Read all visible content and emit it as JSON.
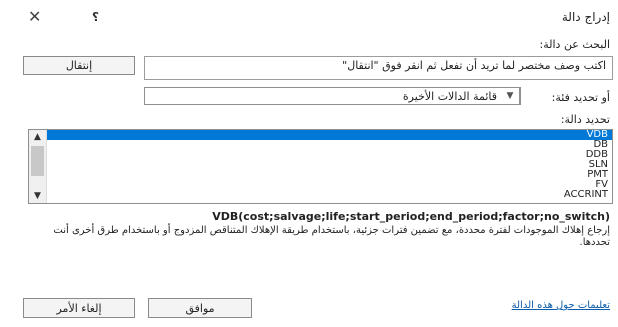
{
  "window": {
    "title": "إدراج دالة"
  },
  "search": {
    "label": "البحث عن دالة:",
    "value": "اكتب وصف مختصر لما تريد أن تفعل ثم انقر فوق \"انتقال\"",
    "go_label": "إنتقال"
  },
  "category": {
    "label": "أو تحديد فئة:",
    "selected": "قائمة الدالات الأخيرة"
  },
  "functions": {
    "label": "تحديد دالة:",
    "items": [
      "VDB",
      "DB",
      "DDB",
      "SLN",
      "PMT",
      "FV",
      "ACCRINT"
    ],
    "selected": "VDB"
  },
  "details": {
    "signature": "VDB(cost;salvage;life;start_period;end_period;factor;no_switch)",
    "description": "إرجاع إهلاك الموجودات لفترة محددة، مع تضمين فترات جزئية، باستخدام طريقة الإهلاك المتناقص المزدوج أو باستخدام طرق أخرى أنت تحددها."
  },
  "footer": {
    "help_link": "تعليمات حول هذه الدالة",
    "ok_label": "موافق",
    "cancel_label": "إلغاء الأمر"
  },
  "icons": {
    "close": "close-icon",
    "help": "help-icon",
    "dropdown": "chevron-down-icon"
  }
}
